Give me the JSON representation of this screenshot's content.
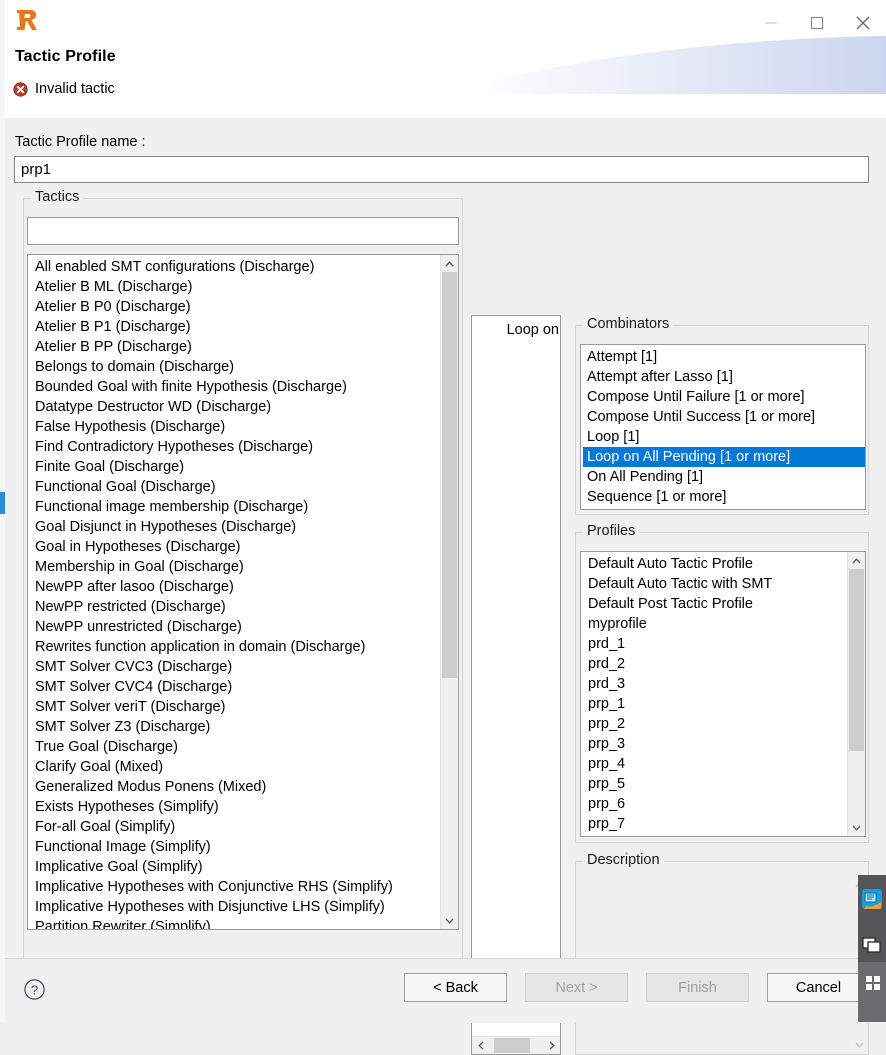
{
  "window": {
    "logo_icon": "rodin-r-logo",
    "minimize_label": "—",
    "maximize_label": "□",
    "close_label": "✕"
  },
  "header": {
    "title": "Tactic Profile",
    "message": "Invalid tactic",
    "message_icon": "error-icon",
    "message_color": "#cc3333"
  },
  "form": {
    "name_label": "Tactic Profile name :",
    "name_value": "prp1",
    "name_placeholder": ""
  },
  "tactics": {
    "group_label": "Tactics",
    "filter_value": "",
    "filter_placeholder": "",
    "items": [
      "All enabled SMT configurations (Discharge)",
      "Atelier B ML (Discharge)",
      "Atelier B P0 (Discharge)",
      "Atelier B P1 (Discharge)",
      "Atelier B PP (Discharge)",
      "Belongs to domain (Discharge)",
      "Bounded Goal with finite Hypothesis (Discharge)",
      "Datatype Destructor WD (Discharge)",
      "False Hypothesis (Discharge)",
      "Find Contradictory Hypotheses (Discharge)",
      "Finite Goal (Discharge)",
      "Functional Goal (Discharge)",
      "Functional image membership (Discharge)",
      "Goal Disjunct in Hypotheses (Discharge)",
      "Goal in Hypotheses (Discharge)",
      "Membership in Goal (Discharge)",
      "NewPP after lasoo (Discharge)",
      "NewPP restricted (Discharge)",
      "NewPP unrestricted (Discharge)",
      "Rewrites function application in domain (Discharge)",
      "SMT Solver CVC3 (Discharge)",
      "SMT Solver CVC4 (Discharge)",
      "SMT Solver veriT (Discharge)",
      "SMT Solver Z3 (Discharge)",
      "True Goal (Discharge)",
      "Clarify Goal (Mixed)",
      "Generalized Modus Ponens (Mixed)",
      "Exists Hypotheses (Simplify)",
      "For-all Goal (Simplify)",
      "Functional Image (Simplify)",
      "Implicative Goal (Simplify)",
      "Implicative Hypotheses with Conjunctive RHS (Simplify)",
      "Implicative Hypotheses with Disjunctive LHS (Simplify)",
      "Partition Rewriter (Simplify)"
    ],
    "selected_index": -1
  },
  "loop_on": {
    "items": [
      "Loop on"
    ],
    "selected_index": -1
  },
  "combinators": {
    "group_label": "Combinators",
    "items": [
      "Attempt [1]",
      "Attempt after Lasso [1]",
      "Compose Until Failure [1 or more]",
      "Compose Until Success [1 or more]",
      "Loop [1]",
      "Loop on All Pending [1 or more]",
      "On All Pending [1]",
      "Sequence [1 or more]"
    ],
    "selected_index": 5,
    "selection_color": "#0078d7"
  },
  "profiles": {
    "group_label": "Profiles",
    "items": [
      "Default Auto Tactic Profile",
      "Default Auto Tactic with SMT",
      "Default Post Tactic Profile",
      "myprofile",
      "prd_1",
      "prd_2",
      "prd_3",
      "prp_1",
      "prp_2",
      "prp_3",
      "prp_4",
      "prp_5",
      "prp_6",
      "prp_7"
    ],
    "selected_index": -1
  },
  "description": {
    "group_label": "Description",
    "text": ""
  },
  "footer": {
    "help_icon": "help-question-icon",
    "buttons": [
      {
        "label": "< Back",
        "enabled": true,
        "name": "back-button"
      },
      {
        "label": "Next >",
        "enabled": false,
        "name": "next-button"
      },
      {
        "label": "Finish",
        "enabled": false,
        "name": "finish-button"
      },
      {
        "label": "Cancel",
        "enabled": true,
        "name": "cancel-button"
      }
    ]
  },
  "dock": {
    "icons": [
      "network-globe-icon",
      "windows-tile-icon",
      "app-window-icon"
    ]
  }
}
